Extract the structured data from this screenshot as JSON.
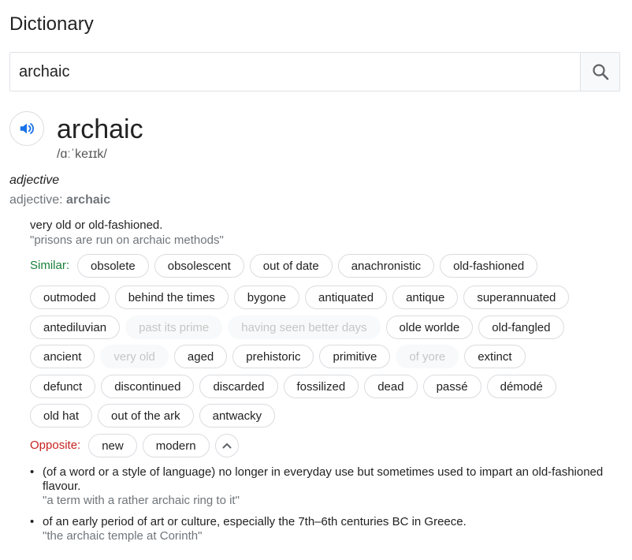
{
  "title": "Dictionary",
  "search": {
    "value": "archaic",
    "icon": "search-icon"
  },
  "entry": {
    "word": "archaic",
    "phonetic": "/ɑːˈkeɪɪk/",
    "part_of_speech": "adjective",
    "form_label": "adjective:",
    "form_word": "archaic"
  },
  "sense1": {
    "definition": "very old or old-fashioned.",
    "example": "\"prisons are run on archaic methods\"",
    "similar_label": "Similar:",
    "similar_rows": [
      [
        "obsolete",
        "obsolescent",
        "out of date",
        "anachronistic",
        "old-fashioned"
      ],
      [
        "outmoded",
        "behind the times",
        "bygone",
        "antiquated",
        "antique",
        "superannuated"
      ],
      [
        "antediluvian",
        "past its prime",
        "having seen better days",
        "olde worlde",
        "old-fangled"
      ],
      [
        "ancient",
        "very old",
        "aged",
        "prehistoric",
        "primitive",
        "of yore",
        "extinct"
      ],
      [
        "defunct",
        "discontinued",
        "discarded",
        "fossilized",
        "dead",
        "passé",
        "démodé"
      ],
      [
        "old hat",
        "out of the ark",
        "antwacky"
      ]
    ],
    "faded_words": [
      "past its prime",
      "having seen better days",
      "very old",
      "of yore"
    ],
    "opposite_label": "Opposite:",
    "opposites": [
      "new",
      "modern"
    ]
  },
  "sense2": {
    "definition": "(of a word or a style of language) no longer in everyday use but sometimes used to impart an old-fashioned flavour.",
    "example": "\"a term with a rather archaic ring to it\""
  },
  "sense3": {
    "definition": "of an early period of art or culture, especially the 7th–6th centuries BC in Greece.",
    "example": "\"the archaic temple at Corinth\""
  },
  "colors": {
    "similar": "#188038",
    "opposite": "#c5221f",
    "speaker": "#1a73e8",
    "muted": "#70757a"
  }
}
